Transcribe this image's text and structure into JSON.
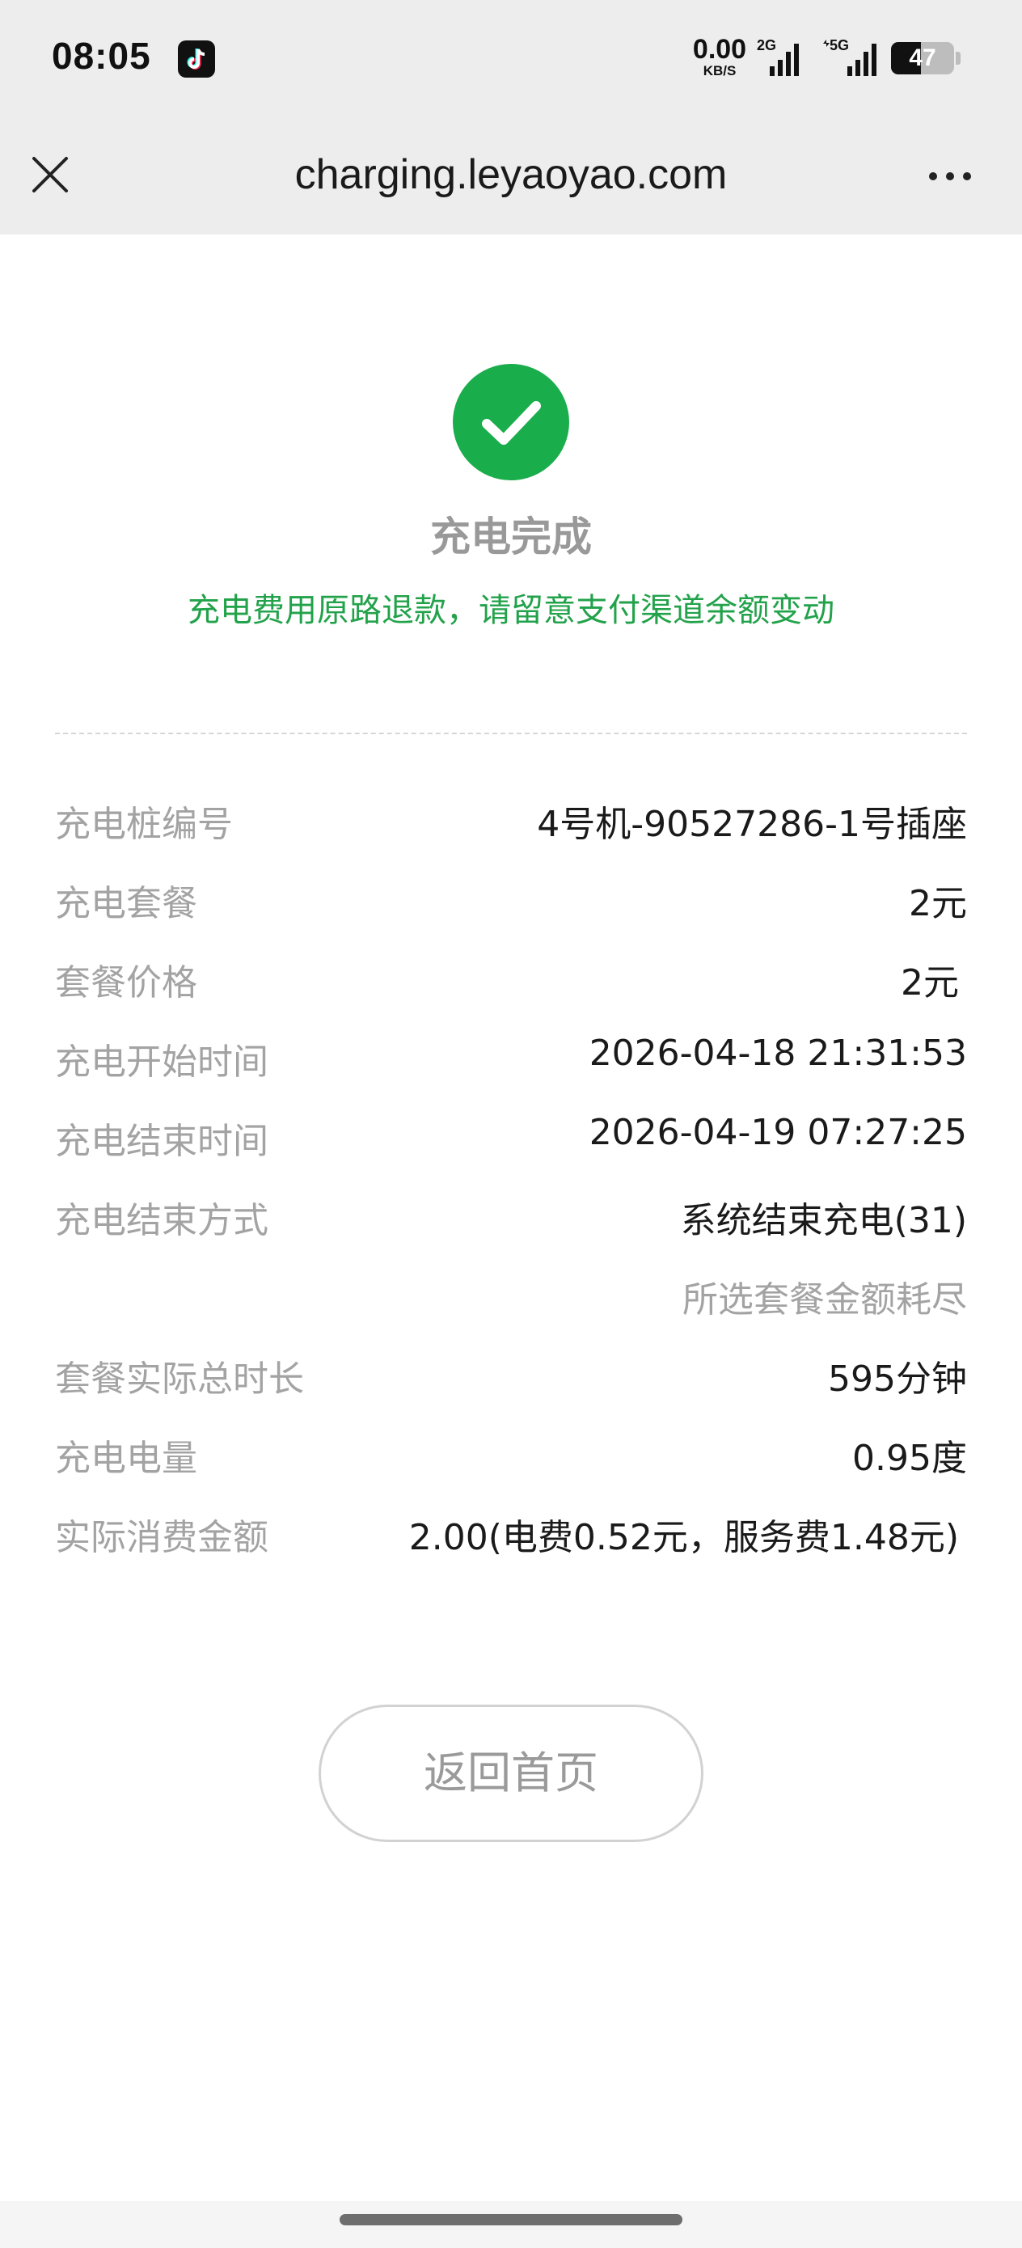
{
  "status_bar": {
    "time": "08:05",
    "app_icon": "tiktok-icon",
    "speed_value": "0.00",
    "speed_unit": "KB/S",
    "network_1": "2G",
    "network_2": "5G",
    "battery_percent": "47",
    "battery_level": 0.47
  },
  "header": {
    "title": "charging.leyaoyao.com",
    "close_icon": "close-icon",
    "more_icon": "more-icon"
  },
  "result": {
    "icon": "check-circle-icon",
    "icon_color": "#1aad4c",
    "title": "充电完成",
    "note": "充电费用原路退款，请留意支付渠道余额变动",
    "note_color": "#22a24a"
  },
  "details": [
    {
      "label": "充电桩编号",
      "value": "4号机-90527286-1号插座"
    },
    {
      "label": "充电套餐",
      "value": "2元"
    },
    {
      "label": "套餐价格",
      "value": "2元"
    },
    {
      "label": "充电开始时间",
      "value": "2026-04-18 21:31:53"
    },
    {
      "label": "充电结束时间",
      "value": "2026-04-19 07:27:25"
    },
    {
      "label": "充电结束方式",
      "value": "系统结束充电(31)"
    },
    {
      "label": "",
      "value": "所选套餐金额耗尽"
    },
    {
      "label": "套餐实际总时长",
      "value": "595分钟"
    },
    {
      "label": "充电电量",
      "value": "0.95度"
    },
    {
      "label": "实际消费金额",
      "value": "2.00(电费0.52元，服务费1.48元)"
    }
  ],
  "actions": {
    "home_label": "返回首页"
  }
}
